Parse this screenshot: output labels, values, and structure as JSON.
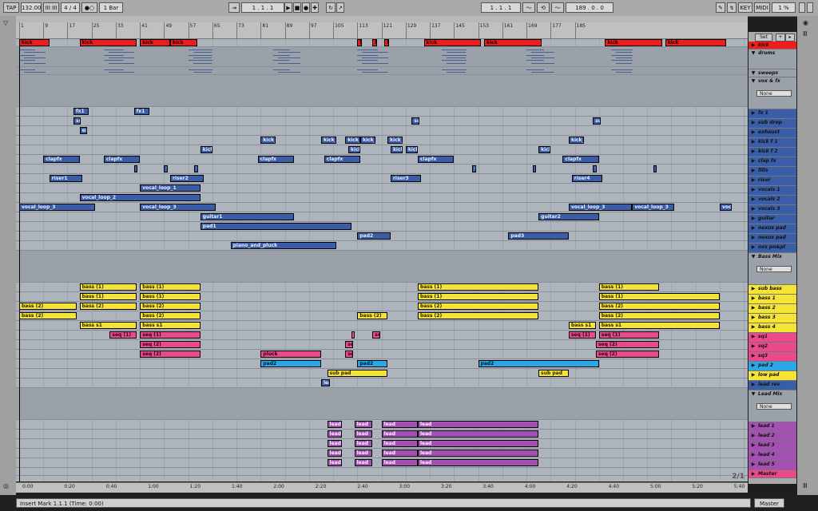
{
  "topbar": {
    "tap": "TAP",
    "tempo": "132.00",
    "beat_glyph": "III III",
    "signature": "4 / 4",
    "metro": "●○",
    "quant": "1 Bar",
    "position": "1 .  1 .  1",
    "loop_start": "1 .  1 .  1",
    "loop_len": "189 .  0 .  0",
    "key": "KEY",
    "midi": "MIDI",
    "cpu": "1 %"
  },
  "ruler_bars": [
    "1",
    "9",
    "17",
    "25",
    "33",
    "41",
    "49",
    "57",
    "65",
    "73",
    "81",
    "89",
    "97",
    "105",
    "113",
    "121",
    "129",
    "137",
    "145",
    "153",
    "161",
    "169",
    "177",
    "185"
  ],
  "time_labels": [
    "0:00",
    "0:20",
    "0:40",
    "1:00",
    "1:20",
    "1:40",
    "2:00",
    "2:20",
    "2:40",
    "3:00",
    "3:20",
    "3:40",
    "4:00",
    "4:20",
    "4:40",
    "5:00",
    "5:20",
    "5:40"
  ],
  "tracks": [
    {
      "name": "kick",
      "kind": "track",
      "color": "#ef1c1c",
      "h": 10
    },
    {
      "name": "drums",
      "kind": "group",
      "color": "#9aa1a9",
      "h": 25
    },
    {
      "name": "sweeps",
      "kind": "group",
      "color": "#9aa1a9",
      "h": 10
    },
    {
      "name": "vox & fx",
      "kind": "group",
      "color": "#9aa1a9",
      "h": 40
    },
    {
      "name": "fx 1",
      "kind": "track",
      "color": "#3a5da8",
      "h": 12
    },
    {
      "name": "sub drop",
      "kind": "track",
      "color": "#3a5da8",
      "h": 12
    },
    {
      "name": "exhaust",
      "kind": "track",
      "color": "#3a5da8",
      "h": 12
    },
    {
      "name": "kick f 1",
      "kind": "track",
      "color": "#3a5da8",
      "h": 12
    },
    {
      "name": "kick f 2",
      "kind": "track",
      "color": "#3a5da8",
      "h": 12
    },
    {
      "name": "clap fx",
      "kind": "track",
      "color": "#3a5da8",
      "h": 12
    },
    {
      "name": "fills",
      "kind": "track",
      "color": "#3a5da8",
      "h": 12
    },
    {
      "name": "riser",
      "kind": "track",
      "color": "#3a5da8",
      "h": 12
    },
    {
      "name": "vocals 1",
      "kind": "track",
      "color": "#3a5da8",
      "h": 12
    },
    {
      "name": "vocals 2",
      "kind": "track",
      "color": "#3a5da8",
      "h": 12
    },
    {
      "name": "vocals 3",
      "kind": "track",
      "color": "#3a5da8",
      "h": 12
    },
    {
      "name": "guitar",
      "kind": "track",
      "color": "#3a5da8",
      "h": 12
    },
    {
      "name": "nexus pad",
      "kind": "track",
      "color": "#3a5da8",
      "h": 12
    },
    {
      "name": "nexus pad",
      "kind": "track",
      "color": "#3a5da8",
      "h": 12
    },
    {
      "name": "nxs pn&pl",
      "kind": "track",
      "color": "#3a5da8",
      "h": 12
    },
    {
      "name": "Bass Mix",
      "kind": "group",
      "color": "#9aa1a9",
      "h": 40
    },
    {
      "name": "sub bass",
      "kind": "track",
      "color": "#f5e436",
      "h": 12
    },
    {
      "name": "bass 1",
      "kind": "track",
      "color": "#f5e436",
      "h": 12
    },
    {
      "name": "bass 2",
      "kind": "track",
      "color": "#f5e436",
      "h": 12
    },
    {
      "name": "bass 3",
      "kind": "track",
      "color": "#f5e436",
      "h": 12
    },
    {
      "name": "bass 4",
      "kind": "track",
      "color": "#f5e436",
      "h": 12
    },
    {
      "name": "sq1",
      "kind": "track",
      "color": "#ea4a8a",
      "h": 12
    },
    {
      "name": "sq2",
      "kind": "track",
      "color": "#ea4a8a",
      "h": 12
    },
    {
      "name": "sq3",
      "kind": "track",
      "color": "#ea4a8a",
      "h": 12
    },
    {
      "name": "pad 2",
      "kind": "track",
      "color": "#29a7e6",
      "h": 12
    },
    {
      "name": "low pad",
      "kind": "track",
      "color": "#f5e436",
      "h": 12
    },
    {
      "name": "lead rev",
      "kind": "track",
      "color": "#3a5da8",
      "h": 12
    },
    {
      "name": "Lead Mix",
      "kind": "group",
      "color": "#9aa1a9",
      "h": 40
    },
    {
      "name": "lead 1",
      "kind": "track",
      "color": "#a44fb2",
      "h": 12
    },
    {
      "name": "lead 2",
      "kind": "track",
      "color": "#a44fb2",
      "h": 12
    },
    {
      "name": "lead 3",
      "kind": "track",
      "color": "#a44fb2",
      "h": 12
    },
    {
      "name": "lead 4",
      "kind": "track",
      "color": "#a44fb2",
      "h": 12
    },
    {
      "name": "lead 5",
      "kind": "track",
      "color": "#a44fb2",
      "h": 12
    },
    {
      "name": "Master",
      "kind": "master",
      "color": "#ea4a8a",
      "h": 10
    }
  ],
  "clips": [
    {
      "t": 0,
      "b": 1,
      "len": 10,
      "n": "kick",
      "c": "red"
    },
    {
      "t": 0,
      "b": 21,
      "len": 19,
      "n": "kick",
      "c": "red"
    },
    {
      "t": 0,
      "b": 41,
      "len": 10,
      "n": "kick",
      "c": "red"
    },
    {
      "t": 0,
      "b": 51,
      "len": 9,
      "n": "kick",
      "c": "red"
    },
    {
      "t": 0,
      "b": 113,
      "len": 1.5,
      "n": "k",
      "c": "red"
    },
    {
      "t": 0,
      "b": 118,
      "len": 1.5,
      "n": "k",
      "c": "red"
    },
    {
      "t": 0,
      "b": 122,
      "len": 1.5,
      "n": "k",
      "c": "red"
    },
    {
      "t": 0,
      "b": 135,
      "len": 19,
      "n": "kick",
      "c": "red"
    },
    {
      "t": 0,
      "b": 155,
      "len": 19,
      "n": "kick",
      "c": "red"
    },
    {
      "t": 0,
      "b": 195,
      "len": 19,
      "n": "kick",
      "c": "red"
    },
    {
      "t": 0,
      "b": 215,
      "len": 20,
      "n": "kick",
      "c": "red"
    },
    {
      "t": 4,
      "b": 19,
      "len": 5,
      "n": "fx1",
      "c": "blue"
    },
    {
      "t": 4,
      "b": 39,
      "len": 5,
      "n": "fx1",
      "c": "blue"
    },
    {
      "t": 5,
      "b": 19,
      "len": 2.5,
      "n": "su",
      "c": "blue"
    },
    {
      "t": 5,
      "b": 131,
      "len": 2.5,
      "n": "su",
      "c": "blue"
    },
    {
      "t": 5,
      "b": 191,
      "len": 2.5,
      "n": "su",
      "c": "blue"
    },
    {
      "t": 6,
      "b": 21,
      "len": 2.5,
      "n": "exl",
      "c": "blue"
    },
    {
      "t": 7,
      "b": 81,
      "len": 5,
      "n": "kick_f",
      "c": "blue"
    },
    {
      "t": 7,
      "b": 101,
      "len": 5,
      "n": "kick_f",
      "c": "blue"
    },
    {
      "t": 7,
      "b": 109,
      "len": 5,
      "n": "kick_f",
      "c": "blue"
    },
    {
      "t": 7,
      "b": 114,
      "len": 5,
      "n": "kick_f",
      "c": "blue"
    },
    {
      "t": 7,
      "b": 123,
      "len": 5,
      "n": "kick_f",
      "c": "blue"
    },
    {
      "t": 7,
      "b": 183,
      "len": 5,
      "n": "kick_f",
      "c": "blue"
    },
    {
      "t": 8,
      "b": 61,
      "len": 4,
      "n": "kick",
      "c": "blue"
    },
    {
      "t": 8,
      "b": 110,
      "len": 4,
      "n": "kick",
      "c": "blue"
    },
    {
      "t": 8,
      "b": 124,
      "len": 4,
      "n": "kick",
      "c": "blue"
    },
    {
      "t": 8,
      "b": 129,
      "len": 4,
      "n": "kick",
      "c": "blue"
    },
    {
      "t": 8,
      "b": 173,
      "len": 4,
      "n": "kick",
      "c": "blue"
    },
    {
      "t": 9,
      "b": 9,
      "len": 12,
      "n": "clapfx",
      "c": "blue"
    },
    {
      "t": 9,
      "b": 29,
      "len": 12,
      "n": "clapfx",
      "c": "blue"
    },
    {
      "t": 9,
      "b": 80,
      "len": 12,
      "n": "clapfx",
      "c": "blue"
    },
    {
      "t": 9,
      "b": 102,
      "len": 12,
      "n": "clapfx",
      "c": "blue"
    },
    {
      "t": 9,
      "b": 133,
      "len": 12,
      "n": "clapfx",
      "c": "blue"
    },
    {
      "t": 9,
      "b": 181,
      "len": 12,
      "n": "clapfx",
      "c": "blue"
    },
    {
      "t": 10,
      "b": 39,
      "len": 1.2,
      "n": "f",
      "c": "blue"
    },
    {
      "t": 10,
      "b": 49,
      "len": 1.2,
      "n": "f",
      "c": "blue"
    },
    {
      "t": 10,
      "b": 59,
      "len": 1.2,
      "n": "f",
      "c": "blue"
    },
    {
      "t": 10,
      "b": 151,
      "len": 1.2,
      "n": "f",
      "c": "blue"
    },
    {
      "t": 10,
      "b": 171,
      "len": 1.2,
      "n": "f",
      "c": "blue"
    },
    {
      "t": 10,
      "b": 191,
      "len": 1.2,
      "n": "f",
      "c": "blue"
    },
    {
      "t": 10,
      "b": 211,
      "len": 1.2,
      "n": "f",
      "c": "blue"
    },
    {
      "t": 11,
      "b": 11,
      "len": 11,
      "n": "riser1",
      "c": "blue"
    },
    {
      "t": 11,
      "b": 51,
      "len": 11,
      "n": "riser2",
      "c": "blue"
    },
    {
      "t": 11,
      "b": 124,
      "len": 10,
      "n": "riser3",
      "c": "blue"
    },
    {
      "t": 11,
      "b": 184,
      "len": 10,
      "n": "riser4",
      "c": "blue"
    },
    {
      "t": 12,
      "b": 41,
      "len": 20,
      "n": "vocal_loop_1",
      "c": "blue"
    },
    {
      "t": 13,
      "b": 21,
      "len": 40,
      "n": "vocal_loop_2",
      "c": "blue"
    },
    {
      "t": 14,
      "b": 1,
      "len": 25,
      "n": "vocal_loop_3",
      "c": "blue"
    },
    {
      "t": 14,
      "b": 41,
      "len": 25,
      "n": "vocal_loop_3",
      "c": "blue"
    },
    {
      "t": 14,
      "b": 183,
      "len": 21,
      "n": "vocal_loop_3",
      "c": "blue"
    },
    {
      "t": 14,
      "b": 204,
      "len": 14,
      "n": "vocal_loop_3",
      "c": "blue"
    },
    {
      "t": 14,
      "b": 233,
      "len": 4,
      "n": "voca",
      "c": "blue"
    },
    {
      "t": 15,
      "b": 61,
      "len": 31,
      "n": "guitar1",
      "c": "blue"
    },
    {
      "t": 15,
      "b": 173,
      "len": 20,
      "n": "guitar2",
      "c": "blue"
    },
    {
      "t": 16,
      "b": 61,
      "len": 50,
      "n": "pad1",
      "c": "blue"
    },
    {
      "t": 17,
      "b": 113,
      "len": 11,
      "n": "pad2",
      "c": "blue"
    },
    {
      "t": 17,
      "b": 163,
      "len": 20,
      "n": "pad3",
      "c": "blue"
    },
    {
      "t": 18,
      "b": 71,
      "len": 35,
      "n": "piano_and_pluck",
      "c": "blue"
    },
    {
      "t": 20,
      "b": 21,
      "len": 19,
      "n": "bass (1)",
      "c": "yellow"
    },
    {
      "t": 20,
      "b": 41,
      "len": 20,
      "n": "bass (1)",
      "c": "yellow"
    },
    {
      "t": 20,
      "b": 133,
      "len": 40,
      "n": "bass (1)",
      "c": "yellow"
    },
    {
      "t": 20,
      "b": 193,
      "len": 20,
      "n": "bass (1)",
      "c": "yellow"
    },
    {
      "t": 21,
      "b": 21,
      "len": 19,
      "n": "bass (1)",
      "c": "yellow"
    },
    {
      "t": 21,
      "b": 41,
      "len": 20,
      "n": "bass (1)",
      "c": "yellow"
    },
    {
      "t": 21,
      "b": 133,
      "len": 40,
      "n": "bass (1)",
      "c": "yellow"
    },
    {
      "t": 21,
      "b": 193,
      "len": 40,
      "n": "bass (1)",
      "c": "yellow"
    },
    {
      "t": 22,
      "b": 1,
      "len": 19,
      "n": "bass (2)",
      "c": "yellow"
    },
    {
      "t": 22,
      "b": 21,
      "len": 19,
      "n": "bass (2)",
      "c": "yellow"
    },
    {
      "t": 22,
      "b": 41,
      "len": 20,
      "n": "bass (2)",
      "c": "yellow"
    },
    {
      "t": 22,
      "b": 133,
      "len": 40,
      "n": "bass (2)",
      "c": "yellow"
    },
    {
      "t": 22,
      "b": 193,
      "len": 40,
      "n": "bass (2)",
      "c": "yellow"
    },
    {
      "t": 23,
      "b": 1,
      "len": 19,
      "n": "bass (2)",
      "c": "yellow"
    },
    {
      "t": 23,
      "b": 41,
      "len": 20,
      "n": "bass (2)",
      "c": "yellow"
    },
    {
      "t": 23,
      "b": 113,
      "len": 10,
      "n": "bass (2)",
      "c": "yellow"
    },
    {
      "t": 23,
      "b": 133,
      "len": 40,
      "n": "bass (2)",
      "c": "yellow"
    },
    {
      "t": 23,
      "b": 193,
      "len": 40,
      "n": "bass (2)",
      "c": "yellow"
    },
    {
      "t": 24,
      "b": 21,
      "len": 19,
      "n": "bass s1",
      "c": "yellow"
    },
    {
      "t": 24,
      "b": 41,
      "len": 20,
      "n": "bass s1",
      "c": "yellow"
    },
    {
      "t": 24,
      "b": 183,
      "len": 9,
      "n": "bass s1",
      "c": "yellow"
    },
    {
      "t": 24,
      "b": 193,
      "len": 40,
      "n": "bass s1",
      "c": "yellow"
    },
    {
      "t": 25,
      "b": 31,
      "len": 9,
      "n": "seq (1)",
      "c": "pink"
    },
    {
      "t": 25,
      "b": 41,
      "len": 20,
      "n": "seq (1)",
      "c": "pink"
    },
    {
      "t": 25,
      "b": 111,
      "len": 1.2,
      "n": "s",
      "c": "pink"
    },
    {
      "t": 25,
      "b": 118,
      "len": 2.5,
      "n": "se",
      "c": "pink"
    },
    {
      "t": 25,
      "b": 183,
      "len": 9,
      "n": "seq (1)",
      "c": "pink"
    },
    {
      "t": 25,
      "b": 193,
      "len": 20,
      "n": "seq (1)",
      "c": "pink"
    },
    {
      "t": 26,
      "b": 41,
      "len": 20,
      "n": "seq (2)",
      "c": "pink"
    },
    {
      "t": 26,
      "b": 109,
      "len": 2.5,
      "n": "se",
      "c": "pink"
    },
    {
      "t": 26,
      "b": 192,
      "len": 21,
      "n": "seq (2)",
      "c": "pink"
    },
    {
      "t": 27,
      "b": 41,
      "len": 20,
      "n": "seq (2)",
      "c": "pink"
    },
    {
      "t": 27,
      "b": 81,
      "len": 20,
      "n": "pluck",
      "c": "pink"
    },
    {
      "t": 27,
      "b": 109,
      "len": 2.5,
      "n": "se",
      "c": "pink"
    },
    {
      "t": 27,
      "b": 192,
      "len": 21,
      "n": "seq (2)",
      "c": "pink"
    },
    {
      "t": 28,
      "b": 81,
      "len": 20,
      "n": "pad2",
      "c": "cyan"
    },
    {
      "t": 28,
      "b": 113,
      "len": 10,
      "n": "pad2",
      "c": "cyan"
    },
    {
      "t": 28,
      "b": 153,
      "len": 40,
      "n": "pad2",
      "c": "cyan"
    },
    {
      "t": 29,
      "b": 103,
      "len": 20,
      "n": "sub pad",
      "c": "yellow"
    },
    {
      "t": 29,
      "b": 173,
      "len": 10,
      "n": "sub pad",
      "c": "yellow"
    },
    {
      "t": 30,
      "b": 101,
      "len": 3,
      "n": "lea",
      "c": "blue"
    },
    {
      "t": 32,
      "b": 103,
      "len": 5,
      "n": "lead",
      "c": "purple"
    },
    {
      "t": 32,
      "b": 112,
      "len": 6,
      "n": "lead",
      "c": "purple"
    },
    {
      "t": 32,
      "b": 121,
      "len": 12,
      "n": "lead",
      "c": "purple"
    },
    {
      "t": 32,
      "b": 133,
      "len": 40,
      "n": "lead",
      "c": "purple"
    },
    {
      "t": 33,
      "b": 103,
      "len": 5,
      "n": "lead",
      "c": "purple"
    },
    {
      "t": 33,
      "b": 112,
      "len": 6,
      "n": "lead",
      "c": "purple"
    },
    {
      "t": 33,
      "b": 121,
      "len": 12,
      "n": "lead",
      "c": "purple"
    },
    {
      "t": 33,
      "b": 133,
      "len": 40,
      "n": "lead",
      "c": "purple"
    },
    {
      "t": 34,
      "b": 103,
      "len": 5,
      "n": "lead",
      "c": "purple"
    },
    {
      "t": 34,
      "b": 112,
      "len": 6,
      "n": "lead",
      "c": "purple"
    },
    {
      "t": 34,
      "b": 121,
      "len": 12,
      "n": "lead",
      "c": "purple"
    },
    {
      "t": 34,
      "b": 133,
      "len": 40,
      "n": "lead",
      "c": "purple"
    },
    {
      "t": 35,
      "b": 103,
      "len": 5,
      "n": "lead",
      "c": "purple"
    },
    {
      "t": 35,
      "b": 112,
      "len": 6,
      "n": "lead",
      "c": "purple"
    },
    {
      "t": 35,
      "b": 121,
      "len": 12,
      "n": "lead",
      "c": "purple"
    },
    {
      "t": 35,
      "b": 133,
      "len": 40,
      "n": "lead",
      "c": "purple"
    },
    {
      "t": 36,
      "b": 103,
      "len": 5,
      "n": "lead",
      "c": "purple"
    },
    {
      "t": 36,
      "b": 112,
      "len": 6,
      "n": "lead",
      "c": "purple"
    },
    {
      "t": 36,
      "b": 121,
      "len": 12,
      "n": "lead",
      "c": "purple"
    },
    {
      "t": 36,
      "b": 133,
      "len": 40,
      "n": "lead",
      "c": "purple"
    }
  ],
  "group_dropdown": "None",
  "set_label": "Set",
  "status": "Insert Mark 1.1.1 (Time: 0:00)",
  "master_label": "Master",
  "overview_readout": "2/1"
}
